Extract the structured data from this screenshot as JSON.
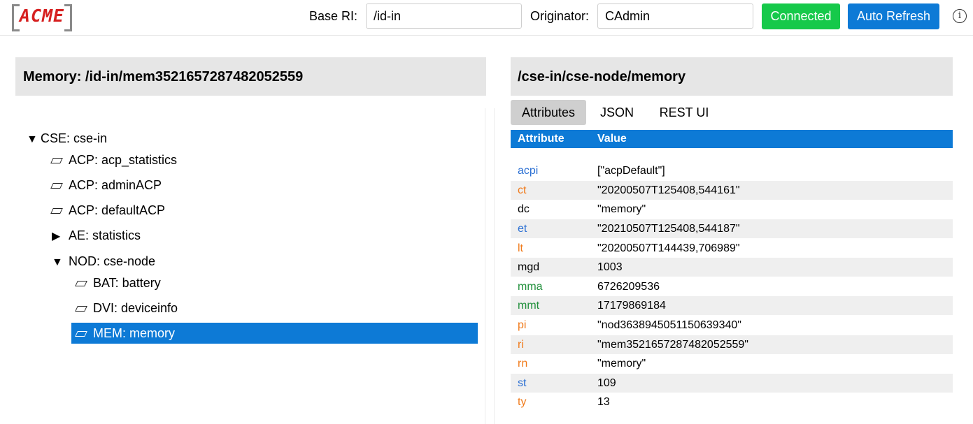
{
  "topbar": {
    "logo_text": "ACME",
    "base_ri_label": "Base RI:",
    "base_ri_value": "/id-in",
    "originator_label": "Originator:",
    "originator_value": "CAdmin",
    "connected_label": "Connected",
    "auto_refresh_label": "Auto Refresh",
    "info_symbol": "ⓘ",
    "colors": {
      "connected": "#16c94a",
      "accent": "#0d7ad6",
      "logo": "#d62020"
    }
  },
  "left": {
    "title": "Memory: /id-in/mem3521657287482052559",
    "tree": [
      {
        "toggle": "▼",
        "label": "CSE: cse-in",
        "kind": "expanded"
      },
      {
        "toggle": "",
        "label": "ACP: acp_statistics",
        "kind": "leaf"
      },
      {
        "toggle": "",
        "label": "ACP: adminACP",
        "kind": "leaf"
      },
      {
        "toggle": "",
        "label": "ACP: defaultACP",
        "kind": "leaf"
      },
      {
        "toggle": "▶",
        "label": "AE: statistics",
        "kind": "collapsed"
      },
      {
        "toggle": "▼",
        "label": "NOD: cse-node",
        "kind": "expanded"
      },
      {
        "toggle": "",
        "label": "BAT: battery",
        "kind": "leaf"
      },
      {
        "toggle": "",
        "label": "DVI: deviceinfo",
        "kind": "leaf"
      },
      {
        "toggle": "",
        "label": "MEM: memory",
        "kind": "leaf",
        "selected": true
      }
    ]
  },
  "right": {
    "title": "/cse-in/cse-node/memory",
    "tabs": [
      {
        "label": "Attributes",
        "active": true
      },
      {
        "label": "JSON",
        "active": false
      },
      {
        "label": "REST UI",
        "active": false
      }
    ],
    "columns": {
      "attribute": "Attribute",
      "value": "Value"
    },
    "attributes": [
      {
        "key": "acpi",
        "value": "[\"acpDefault\"]",
        "color": "blue"
      },
      {
        "key": "ct",
        "value": "\"20200507T125408,544161\"",
        "color": "orange"
      },
      {
        "key": "dc",
        "value": "\"memory\"",
        "color": "black"
      },
      {
        "key": "et",
        "value": "\"20210507T125408,544187\"",
        "color": "blue"
      },
      {
        "key": "lt",
        "value": "\"20200507T144439,706989\"",
        "color": "orange"
      },
      {
        "key": "mgd",
        "value": "1003",
        "color": "black"
      },
      {
        "key": "mma",
        "value": "6726209536",
        "color": "green"
      },
      {
        "key": "mmt",
        "value": "17179869184",
        "color": "green"
      },
      {
        "key": "pi",
        "value": "\"nod3638945051150639340\"",
        "color": "orange"
      },
      {
        "key": "ri",
        "value": "\"mem3521657287482052559\"",
        "color": "orange"
      },
      {
        "key": "rn",
        "value": "\"memory\"",
        "color": "orange"
      },
      {
        "key": "st",
        "value": "109",
        "color": "blue"
      },
      {
        "key": "ty",
        "value": "13",
        "color": "orange"
      }
    ]
  }
}
